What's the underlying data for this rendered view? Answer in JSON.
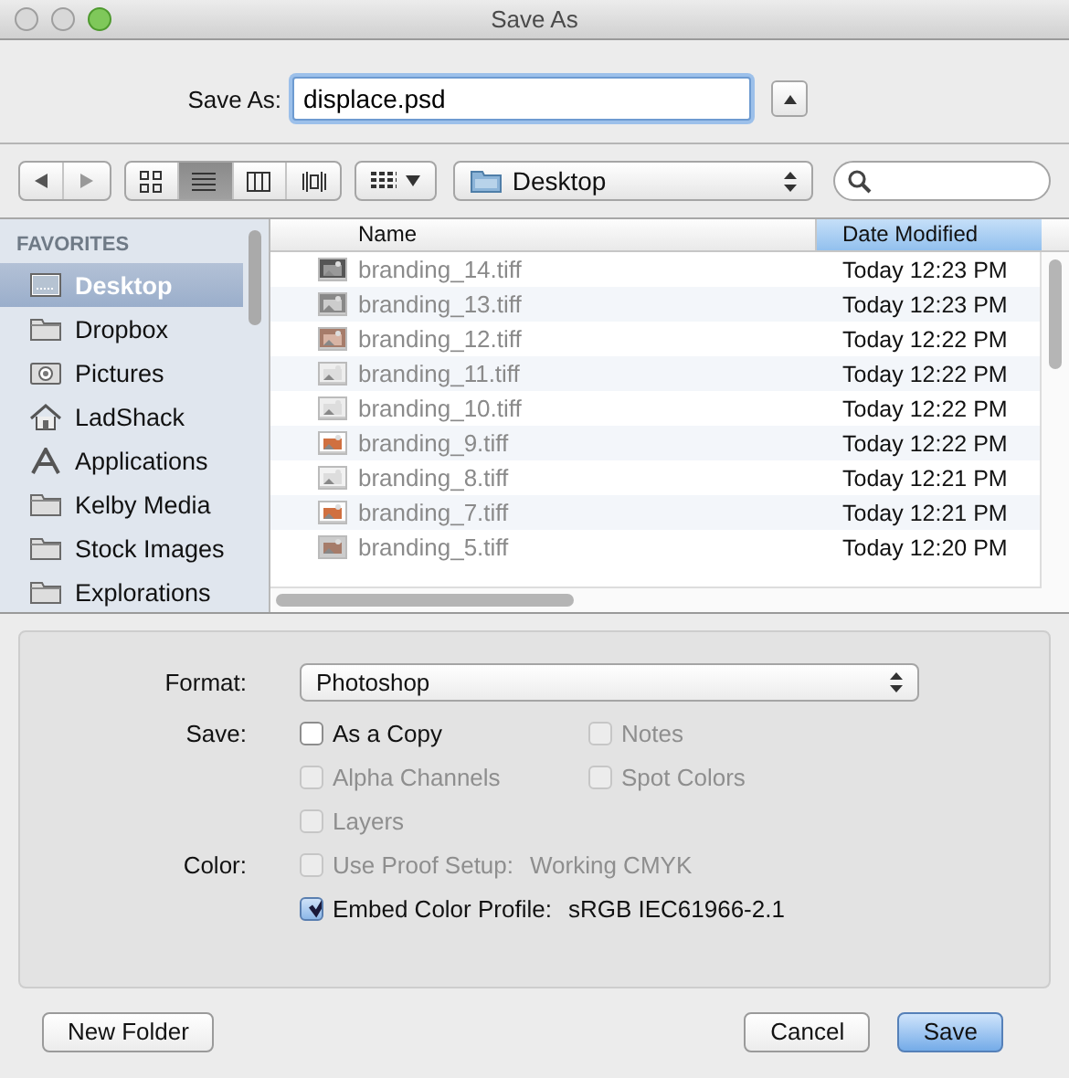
{
  "window": {
    "title": "Save As"
  },
  "save_as": {
    "label": "Save As:",
    "value": "displace.psd",
    "expanded": false
  },
  "toolbar": {
    "views": [
      {
        "selected": false
      },
      {
        "selected": true
      },
      {
        "selected": false
      },
      {
        "selected": false
      }
    ],
    "location": "Desktop"
  },
  "sidebar": {
    "heading": "FAVORITES",
    "items": [
      {
        "label": "Desktop",
        "kind": "desktop",
        "selected": true
      },
      {
        "label": "Dropbox",
        "kind": "folder",
        "selected": false
      },
      {
        "label": "Pictures",
        "kind": "camera",
        "selected": false
      },
      {
        "label": "LadShack",
        "kind": "home",
        "selected": false
      },
      {
        "label": "Applications",
        "kind": "apps",
        "selected": false
      },
      {
        "label": "Kelby Media",
        "kind": "folder",
        "selected": false
      },
      {
        "label": "Stock Images",
        "kind": "folder",
        "selected": false
      },
      {
        "label": "Explorations",
        "kind": "folder",
        "selected": false
      }
    ]
  },
  "table": {
    "columns": [
      {
        "label": "Name",
        "selected": false
      },
      {
        "label": "Date Modified",
        "selected": true
      }
    ],
    "rows": [
      {
        "name": "branding_14.tiff",
        "date": "Today 12:23 PM",
        "disabled": true
      },
      {
        "name": "branding_13.tiff",
        "date": "Today 12:23 PM",
        "disabled": true
      },
      {
        "name": "branding_12.tiff",
        "date": "Today 12:22 PM",
        "disabled": true
      },
      {
        "name": "branding_11.tiff",
        "date": "Today 12:22 PM",
        "disabled": true
      },
      {
        "name": "branding_10.tiff",
        "date": "Today 12:22 PM",
        "disabled": true
      },
      {
        "name": "branding_9.tiff",
        "date": "Today 12:22 PM",
        "disabled": true
      },
      {
        "name": "branding_8.tiff",
        "date": "Today 12:21 PM",
        "disabled": true
      },
      {
        "name": "branding_7.tiff",
        "date": "Today 12:21 PM",
        "disabled": true
      },
      {
        "name": "branding_5.tiff",
        "date": "Today 12:20 PM",
        "disabled": true
      }
    ]
  },
  "options": {
    "format_label": "Format:",
    "format": "Photoshop",
    "rows": [
      {
        "label": "Save:",
        "items": [
          {
            "label": "As a Copy",
            "checked": false,
            "disabled": false
          },
          {
            "label": "Notes",
            "checked": false,
            "disabled": true
          }
        ]
      },
      {
        "items": [
          {
            "label": "Alpha Channels",
            "checked": false,
            "disabled": true
          },
          {
            "label": "Spot Colors",
            "checked": false,
            "disabled": true
          }
        ]
      },
      {
        "items": [
          {
            "label": "Layers",
            "checked": false,
            "disabled": true
          }
        ]
      },
      {
        "label": "Color:",
        "items": [
          {
            "label": "Use Proof Setup:",
            "value": "Working CMYK",
            "checked": false,
            "disabled": true
          }
        ]
      },
      {
        "items": [
          {
            "label": "Embed Color Profile:",
            "value": "sRGB IEC61966-2.1",
            "checked": true,
            "disabled": false
          }
        ]
      }
    ]
  },
  "buttons": {
    "left": [
      {
        "label": "New Folder",
        "default": false
      }
    ],
    "right": [
      {
        "label": "Cancel",
        "default": false
      },
      {
        "label": "Save",
        "default": true
      }
    ]
  }
}
